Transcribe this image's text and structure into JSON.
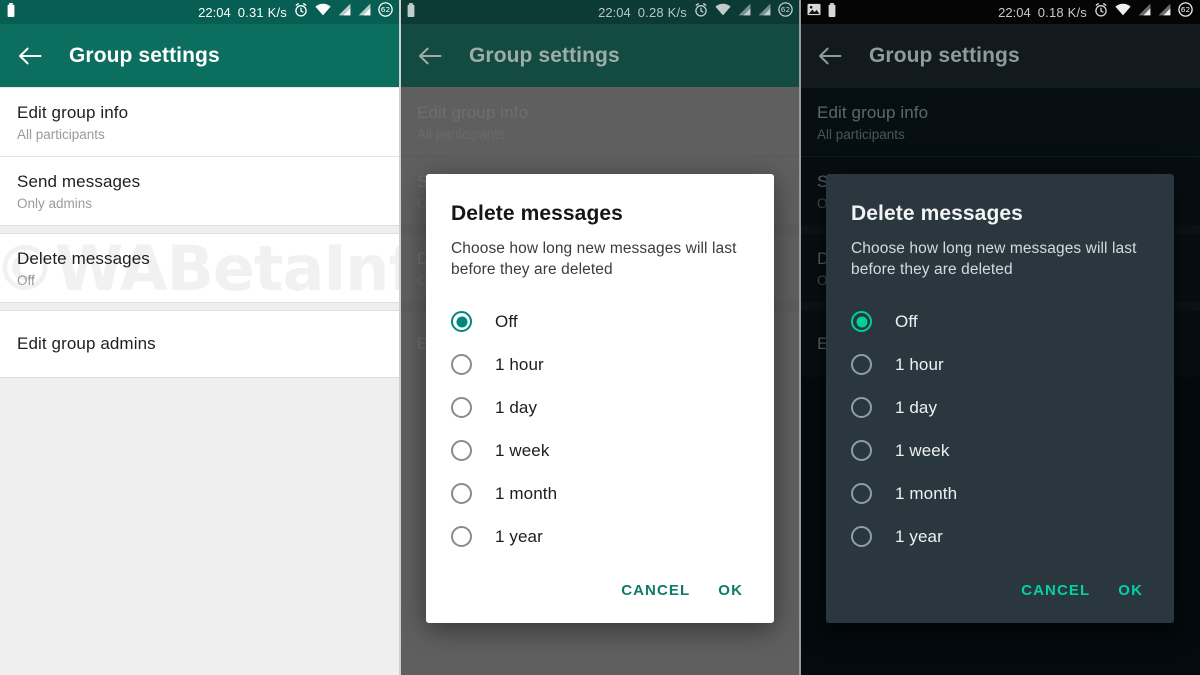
{
  "statusbar": {
    "time": "22:04",
    "icons": {
      "battery": "battery-icon",
      "screenshot": "image-icon",
      "alarm": "alarm-clock-icon",
      "wifi": "wifi-icon",
      "signal1": "signal-bars-icon",
      "signal2": "signal-bars-icon",
      "battery_percent_badge": "62"
    }
  },
  "panels": [
    {
      "id": "light",
      "statusbar": {
        "time": "22:04",
        "netspeed": "0.31 K/s",
        "battery_level": "62"
      },
      "appbar": {
        "title": "Group settings",
        "back": "back-arrow-icon"
      },
      "settings": [
        {
          "title": "Edit group info",
          "subtitle": "All participants"
        },
        {
          "title": "Send messages",
          "subtitle": "Only admins"
        },
        {
          "title": "Delete messages",
          "subtitle": "Off"
        },
        {
          "title": "Edit group admins",
          "subtitle": ""
        }
      ],
      "dialog_visible": false
    },
    {
      "id": "light-dialog",
      "statusbar": {
        "time": "22:04",
        "netspeed": "0.28 K/s",
        "battery_level": "62"
      },
      "appbar": {
        "title": "Group settings",
        "back": "back-arrow-icon"
      },
      "settings": [
        {
          "title": "Edit group info",
          "subtitle": "All participants"
        },
        {
          "title": "Send messages",
          "subtitle": "Only admins"
        },
        {
          "title": "Delete messages",
          "subtitle": "Off"
        },
        {
          "title": "Edit group admins",
          "subtitle": ""
        }
      ],
      "dialog_visible": true
    },
    {
      "id": "dark-dialog",
      "statusbar": {
        "time": "22:04",
        "netspeed": "0.18 K/s",
        "battery_level": "62"
      },
      "appbar": {
        "title": "Group settings",
        "back": "back-arrow-icon"
      },
      "settings": [
        {
          "title": "Edit group info",
          "subtitle": "All participants"
        },
        {
          "title": "Send messages",
          "subtitle": "Only admins"
        },
        {
          "title": "Delete messages",
          "subtitle": "Off"
        },
        {
          "title": "Edit group admins",
          "subtitle": ""
        }
      ],
      "dialog_visible": true
    }
  ],
  "dialog": {
    "title": "Delete messages",
    "description": "Choose how long new messages will last before they are deleted",
    "options": [
      {
        "label": "Off",
        "selected": true
      },
      {
        "label": "1 hour",
        "selected": false
      },
      {
        "label": "1 day",
        "selected": false
      },
      {
        "label": "1 week",
        "selected": false
      },
      {
        "label": "1 month",
        "selected": false
      },
      {
        "label": "1 year",
        "selected": false
      }
    ],
    "cancel_label": "CANCEL",
    "ok_label": "OK"
  },
  "watermark": {
    "text": "©WABetaInfo",
    "vertical_text": "WABetaInfo"
  },
  "colors": {
    "header_green": "#0c6e5e",
    "statusbar_green": "#075e52",
    "accent_teal": "#0f7a68",
    "accent_teal_dark_mode": "#00d2a6",
    "radio_selected_light": "#00897b",
    "radio_selected_dark": "#00d09c",
    "dialog_dark_bg": "#2a373e",
    "dark_page_bg": "#02080b"
  }
}
